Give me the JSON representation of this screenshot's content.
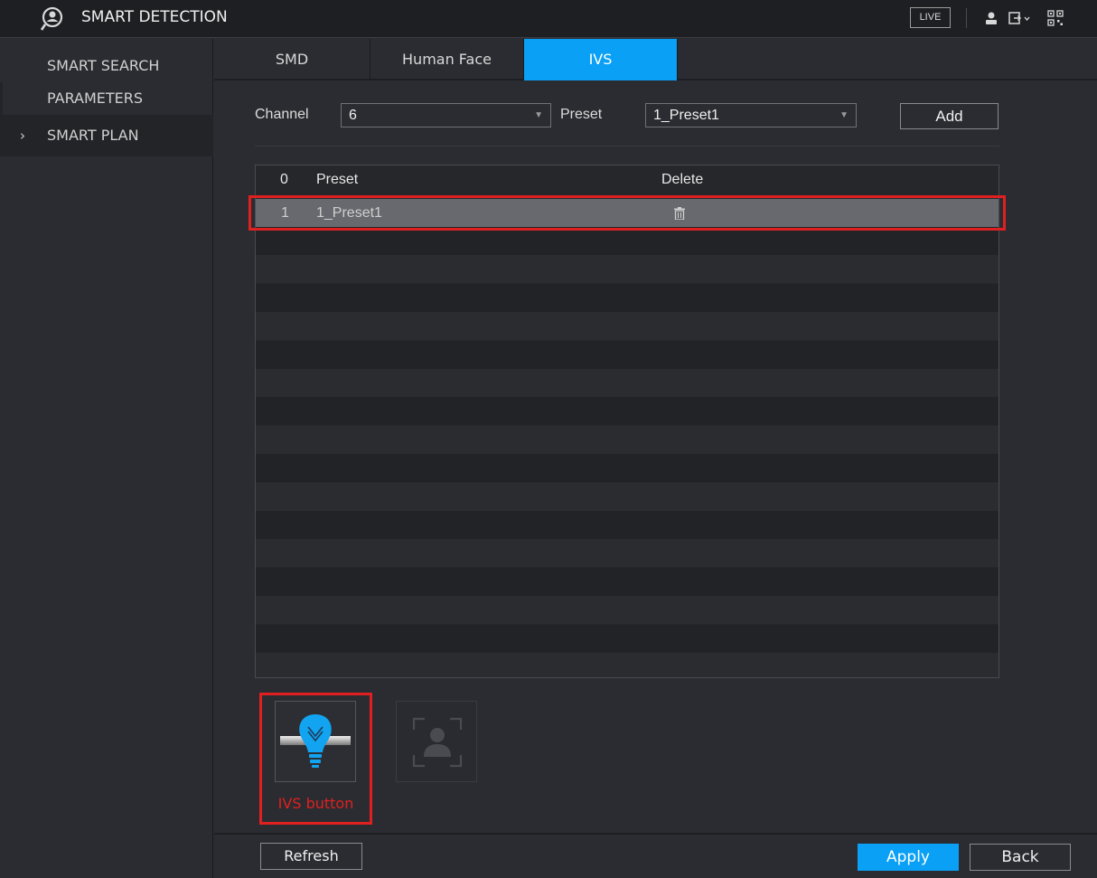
{
  "header": {
    "title": "SMART DETECTION",
    "live_label": "LIVE",
    "icons": [
      "smart-detection-icon",
      "user-icon",
      "logout-icon",
      "qr-code-icon"
    ]
  },
  "sidebar": {
    "items": [
      {
        "label_line1": "SMART SEARCH",
        "label_line2": "PARAMETERS"
      },
      {
        "label": "SMART PLAN",
        "chevron": "›",
        "active": true
      }
    ]
  },
  "tabs": [
    {
      "label": "SMD",
      "active": false
    },
    {
      "label": "Human Face",
      "active": false
    },
    {
      "label": "IVS",
      "active": true
    }
  ],
  "form": {
    "channel_label": "Channel",
    "channel_value": "6",
    "preset_label": "Preset",
    "preset_value": "1_Preset1",
    "add_label": "Add"
  },
  "table": {
    "headers": {
      "index": "0",
      "preset": "Preset",
      "delete": "Delete"
    },
    "rows": [
      {
        "index": "1",
        "preset": "1_Preset1",
        "delete_icon": "trash-icon"
      }
    ]
  },
  "plan_buttons": {
    "ivs_caption": "IVS button",
    "ivs_icon": "ivs-bulb-icon",
    "face_icon": "face-detection-icon"
  },
  "footer": {
    "refresh_label": "Refresh",
    "apply_label": "Apply",
    "back_label": "Back"
  },
  "colors": {
    "accent": "#0aa0f5",
    "highlight": "#e02020",
    "selected_row": "#68696e"
  }
}
